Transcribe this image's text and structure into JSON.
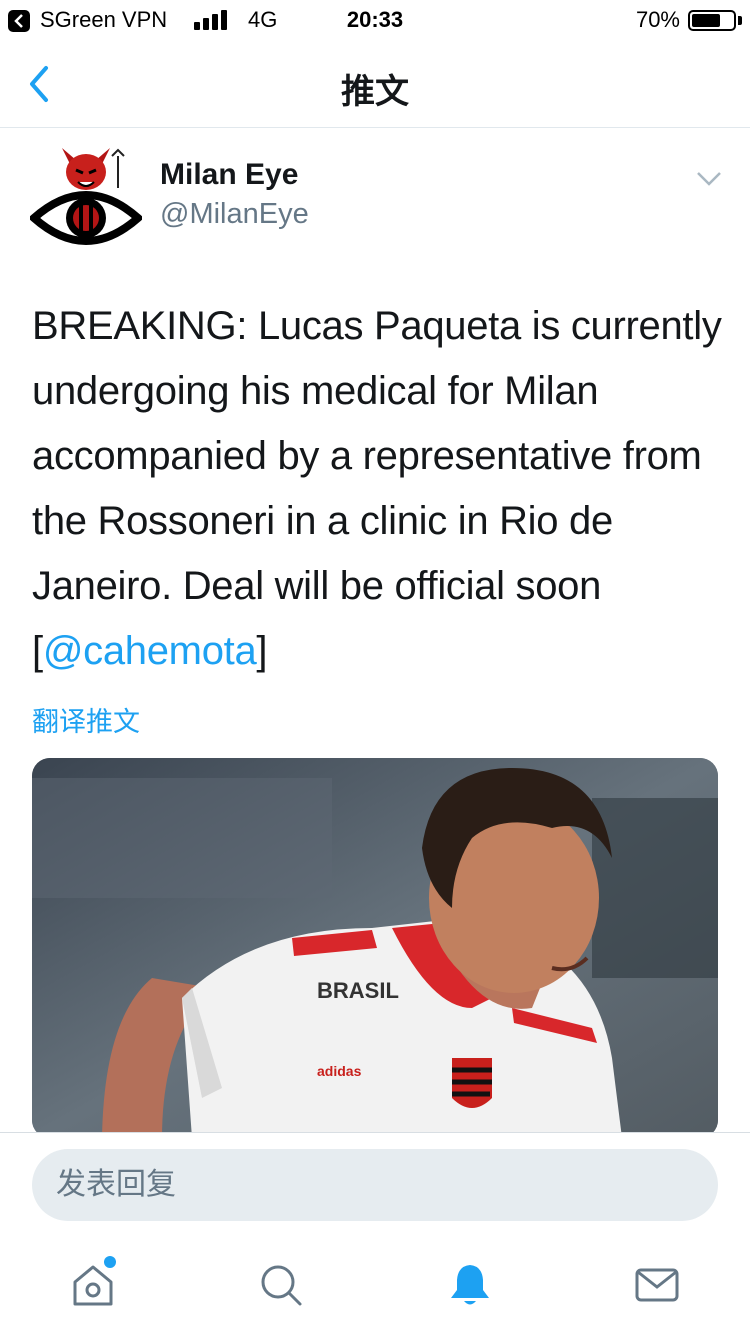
{
  "status_bar": {
    "carrier": "SGreen VPN",
    "network": "4G",
    "time": "20:33",
    "battery_text": "70%",
    "battery_level": 0.7
  },
  "nav": {
    "title": "推文",
    "back_icon": "chevron-left-icon"
  },
  "tweet": {
    "display_name": "Milan Eye",
    "handle": "@MilanEye",
    "text_before_mention": "BREAKING: Lucas Paqueta is currently undergoing his medical for Milan accompanied by a representative from the Rossoneri in a clinic in Rio de Janeiro. Deal will be official soon [",
    "mention": "@cahemota",
    "text_after_mention": "]",
    "translate_label": "翻译推文",
    "photo_alt": "player photo"
  },
  "reply": {
    "placeholder": "发表回复"
  },
  "tabbar": {
    "items": [
      {
        "icon": "home-icon"
      },
      {
        "icon": "search-icon"
      },
      {
        "icon": "bell-icon"
      },
      {
        "icon": "mail-icon"
      }
    ],
    "active_index": 2
  },
  "colors": {
    "accent": "#1da1f2",
    "text": "#14171a",
    "secondary": "#657786"
  }
}
